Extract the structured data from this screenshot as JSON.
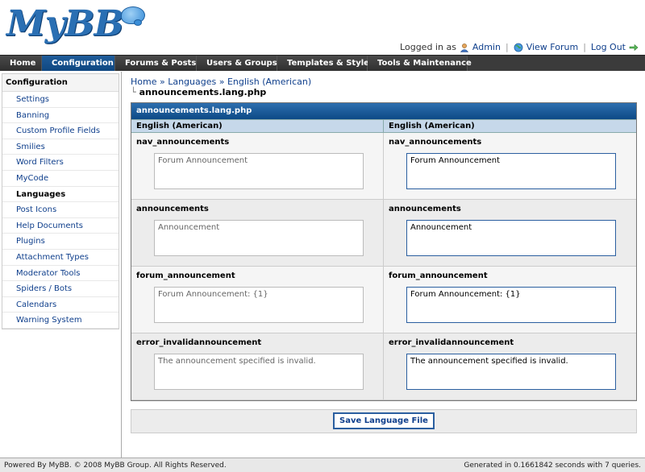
{
  "brand": {
    "name": "MyBB"
  },
  "header": {
    "logged_in_label": "Logged in as",
    "user": "Admin",
    "view_forum": "View Forum",
    "log_out": "Log Out"
  },
  "nav": [
    {
      "label": "Home"
    },
    {
      "label": "Configuration"
    },
    {
      "label": "Forums & Posts"
    },
    {
      "label": "Users & Groups"
    },
    {
      "label": "Templates & Style"
    },
    {
      "label": "Tools & Maintenance"
    }
  ],
  "sidebar": {
    "title": "Configuration",
    "items": [
      {
        "label": "Settings"
      },
      {
        "label": "Banning"
      },
      {
        "label": "Custom Profile Fields"
      },
      {
        "label": "Smilies"
      },
      {
        "label": "Word Filters"
      },
      {
        "label": "MyCode"
      },
      {
        "label": "Languages"
      },
      {
        "label": "Post Icons"
      },
      {
        "label": "Help Documents"
      },
      {
        "label": "Plugins"
      },
      {
        "label": "Attachment Types"
      },
      {
        "label": "Moderator Tools"
      },
      {
        "label": "Spiders / Bots"
      },
      {
        "label": "Calendars"
      },
      {
        "label": "Warning System"
      }
    ]
  },
  "breadcrumb": {
    "home": "Home",
    "sep": "»",
    "languages": "Languages",
    "lang": "English (American)",
    "current": "announcements.lang.php"
  },
  "table": {
    "title": "announcements.lang.php",
    "col_left": "English (American)",
    "col_right": "English (American)",
    "rows": [
      {
        "key": "nav_announcements",
        "left": "Forum Announcement",
        "right": "Forum Announcement"
      },
      {
        "key": "announcements",
        "left": "Announcement",
        "right": "Announcement"
      },
      {
        "key": "forum_announcement",
        "left": "Forum Announcement: {1}",
        "right": "Forum Announcement: {1}"
      },
      {
        "key": "error_invalidannouncement",
        "left": "The announcement specified is invalid.",
        "right": "The announcement specified is invalid."
      }
    ]
  },
  "submit": {
    "label": "Save Language File"
  },
  "footer": {
    "left": "Powered By MyBB. © 2008 MyBB Group. All Rights Reserved.",
    "right": "Generated in 0.1661842 seconds with 7 queries."
  }
}
